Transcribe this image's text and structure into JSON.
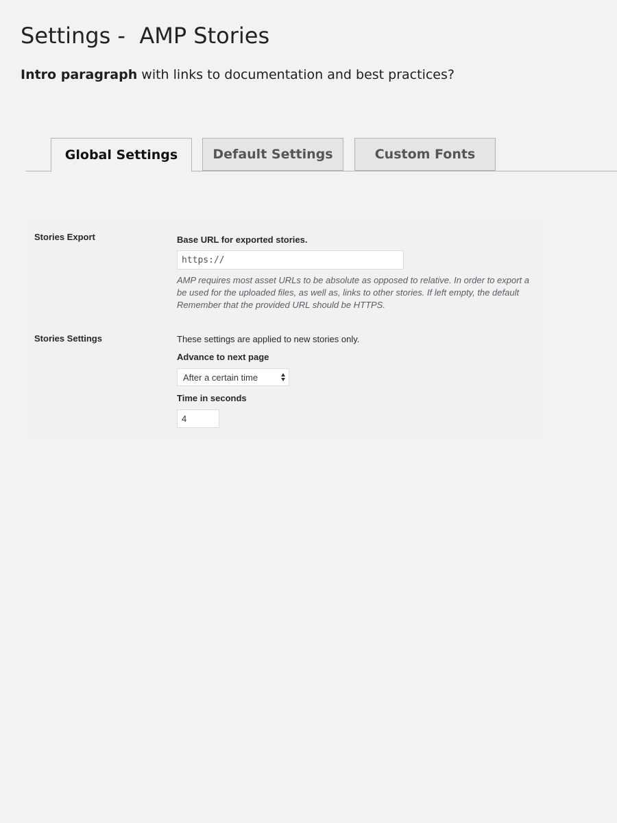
{
  "page": {
    "title": "Settings -  AMP Stories",
    "intro_bold": "Intro paragraph",
    "intro_rest": " with links to documentation and best practices?"
  },
  "tabs": [
    {
      "label": "Global Settings",
      "active": true
    },
    {
      "label": "Default Settings",
      "active": false
    },
    {
      "label": "Custom Fonts",
      "active": false
    }
  ],
  "stories_export": {
    "row_label": "Stories Export",
    "field_label": "Base URL for exported stories.",
    "input_value": "https://",
    "description_lines": [
      "AMP requires most asset URLs to be absolute as opposed to relative. In order to export a",
      "be used for the uploaded files, as well as, links to other stories. If left empty, the default",
      "Remember that the provided URL should be HTTPS."
    ]
  },
  "stories_settings": {
    "row_label": "Stories Settings",
    "note": "These settings are applied to new stories only.",
    "advance_label": "Advance to next page",
    "advance_value": "After a certain time",
    "time_label": "Time in seconds",
    "time_value": "4"
  },
  "colors": {
    "background": "#f2f2f2",
    "tab_inactive": "#e5e5e5",
    "border": "#b4b4b4"
  }
}
